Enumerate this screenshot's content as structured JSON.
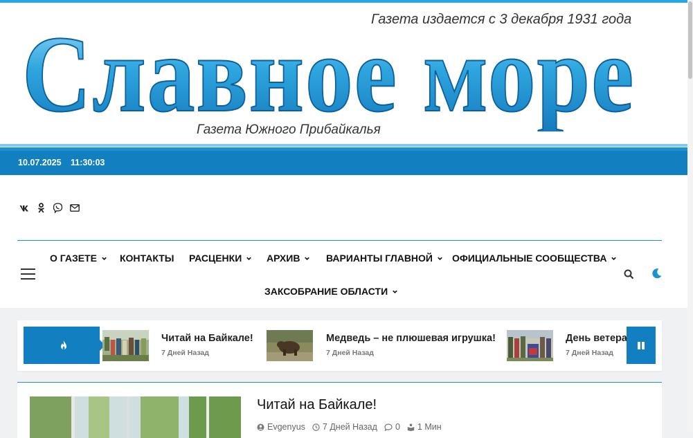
{
  "masthead": {
    "since": "Газета издается с 3 декабря 1931 года",
    "logo_text": "Славное море",
    "subtitle": "Газета Южного Прибайкалья"
  },
  "datebar": {
    "date": "10.07.2025",
    "time": "11:30:03"
  },
  "social": [
    "vk-icon",
    "odnoklassniki-icon",
    "viber-icon",
    "mail-icon"
  ],
  "nav": {
    "items": [
      {
        "label": "О ГАЗЕТЕ",
        "dropdown": true
      },
      {
        "label": "КОНТАКТЫ",
        "dropdown": false
      },
      {
        "label": "РАСЦЕНКИ",
        "dropdown": true
      },
      {
        "label": "АРХИВ",
        "dropdown": true
      },
      {
        "label": "ВАРИАНТЫ ГЛАВНОЙ",
        "dropdown": true
      },
      {
        "label": "ОФИЦИАЛЬНЫЕ СООБЩЕСТВА",
        "dropdown": true
      },
      {
        "label": "ЗАКСОБРАНИЕ ОБЛАСТИ",
        "dropdown": true
      }
    ]
  },
  "ticker": {
    "items": [
      {
        "title": "Читай на Байкале!",
        "date": "7 Дней Назад"
      },
      {
        "title": "Медведь – не плюшевая игрушка!",
        "date": "7 Дней Назад"
      },
      {
        "title": "День ветеранов",
        "date": "7 Дней Назад"
      }
    ]
  },
  "post": {
    "title": "Читай на Байкале!",
    "author": "Evgenyus",
    "date": "7 Дней Назад",
    "comments": "0",
    "read_time": "1 Мин"
  },
  "colors": {
    "brand_blue": "#1280c0",
    "accent_line": "#1d92cf",
    "logo_light": "#29a8e0"
  }
}
